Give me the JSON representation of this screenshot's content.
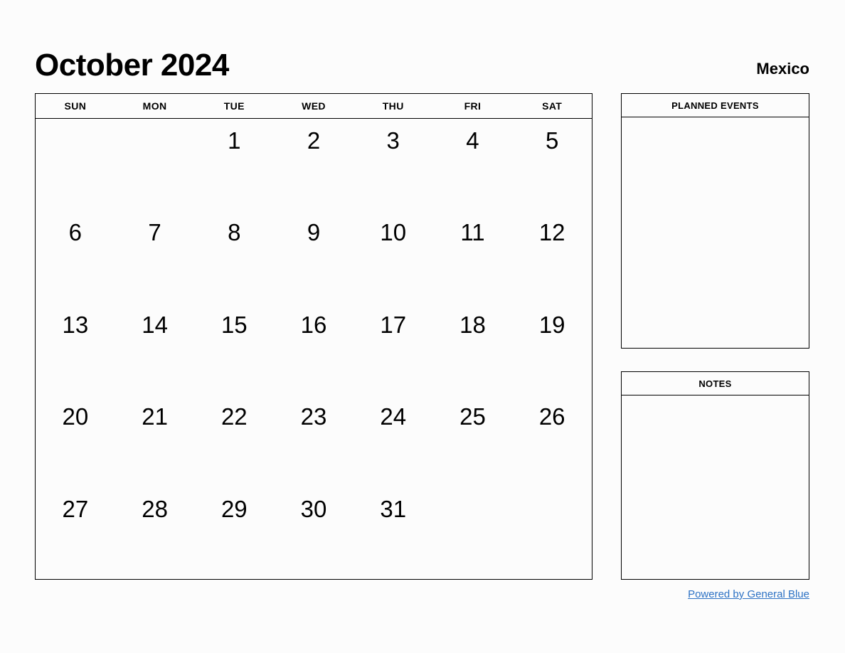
{
  "header": {
    "month_title": "October 2024",
    "region": "Mexico"
  },
  "calendar": {
    "weekdays": [
      "SUN",
      "MON",
      "TUE",
      "WED",
      "THU",
      "FRI",
      "SAT"
    ],
    "weeks": [
      [
        "",
        "",
        "1",
        "2",
        "3",
        "4",
        "5"
      ],
      [
        "6",
        "7",
        "8",
        "9",
        "10",
        "11",
        "12"
      ],
      [
        "13",
        "14",
        "15",
        "16",
        "17",
        "18",
        "19"
      ],
      [
        "20",
        "21",
        "22",
        "23",
        "24",
        "25",
        "26"
      ],
      [
        "27",
        "28",
        "29",
        "30",
        "31",
        "",
        ""
      ]
    ]
  },
  "panels": {
    "planned_events": {
      "title": "PLANNED EVENTS",
      "content": ""
    },
    "notes": {
      "title": "NOTES",
      "content": ""
    }
  },
  "footer": {
    "link_text": "Powered by General Blue",
    "link_color": "#2d72c4"
  },
  "colors": {
    "background": "#fcfcfc",
    "text": "#000000",
    "border": "#000000",
    "link": "#2d72c4"
  }
}
